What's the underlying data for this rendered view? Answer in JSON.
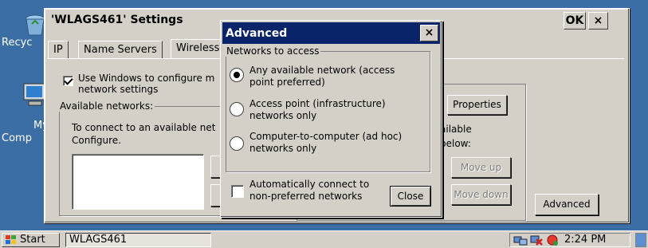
{
  "desktop": {
    "icons": [
      {
        "label": "Recyc"
      },
      {
        "label": "My"
      },
      {
        "label": "Comp"
      }
    ]
  },
  "settings_window": {
    "title": "'WLAGS461' Settings",
    "ok_label": "OK",
    "close_label": "×",
    "tabs": [
      {
        "label": "IP"
      },
      {
        "label": "Name Servers"
      },
      {
        "label": "Wireless"
      }
    ],
    "use_windows_checkbox": {
      "line1": "Use Windows to configure m",
      "line2": "network settings",
      "checked": true
    },
    "available_networks": {
      "title": "Available networks:",
      "desc_line1": "To connect to an available net",
      "desc_line2": "Configure."
    },
    "preferred": {
      "properties_label": "Properties",
      "text_line1": "ailable",
      "text_line2": "below:",
      "move_up_label": "Move up",
      "move_down_label": "Move down"
    },
    "advanced_label": "Advanced"
  },
  "advanced_dialog": {
    "title": "Advanced",
    "close_label": "×",
    "group_title": "Networks to access",
    "options": [
      {
        "line1": "Any available network (access",
        "line2": "point preferred)",
        "selected": true
      },
      {
        "line1": "Access point (infrastructure)",
        "line2": "networks only",
        "selected": false
      },
      {
        "line1": "Computer-to-computer (ad hoc)",
        "line2": "networks only",
        "selected": false
      }
    ],
    "auto_connect": {
      "line1": "Automatically connect to",
      "line2": "non-preferred networks",
      "checked": false
    },
    "close_button_label": "Close"
  },
  "taskbar": {
    "start_label": "Start",
    "task_label": "WLAGS461",
    "time": "2:24 PM",
    "tray_icons": [
      "network-icon",
      "connection-error-icon",
      "wireless-status-icon"
    ]
  },
  "colors": {
    "desktop": "#3a6ea5",
    "active_title": "#0a246a",
    "face": "#d4d0c8"
  }
}
